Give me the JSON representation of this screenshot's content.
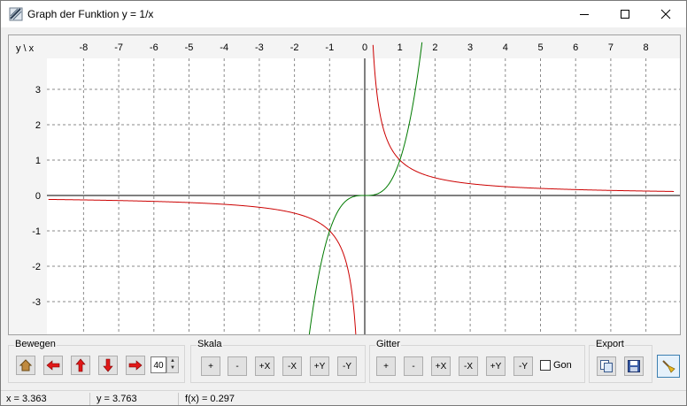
{
  "window": {
    "title": "Graph der Funktion y = 1/x"
  },
  "plot": {
    "corner_label": "y \\ x",
    "x_ticks": [
      "-8",
      "-7",
      "-6",
      "-5",
      "-4",
      "-3",
      "-2",
      "-1",
      "0",
      "1",
      "2",
      "3",
      "4",
      "5",
      "6",
      "7",
      "8"
    ],
    "y_ticks": [
      "3",
      "2",
      "1",
      "0",
      "-1",
      "-2",
      "-3"
    ],
    "xlim": [
      -9,
      8.8
    ],
    "ylim": [
      -3.9,
      3.9
    ],
    "grid": true,
    "curve_colors": {
      "function": "#cc0000",
      "second": "#007a00"
    }
  },
  "chart_data": {
    "type": "line",
    "series": [
      {
        "expression": "y = 1/x",
        "color": "#cc0000"
      },
      {
        "expression": "y = x^3",
        "color": "#007a00"
      }
    ],
    "xlim": [
      -9,
      8.8
    ],
    "ylim": [
      -3.9,
      3.9
    ],
    "grid": true
  },
  "toolbar": {
    "bewegen": {
      "title": "Bewegen",
      "step_value": "40"
    },
    "skala": {
      "title": "Skala",
      "buttons": [
        "+",
        "-",
        "+X",
        "-X",
        "+Y",
        "-Y"
      ]
    },
    "gitter": {
      "title": "Gitter",
      "buttons": [
        "+",
        "-",
        "+X",
        "-X",
        "+Y",
        "-Y"
      ],
      "gon_label": "Gon"
    },
    "export": {
      "title": "Export"
    }
  },
  "status": {
    "x": "x = 3.363",
    "y": "y = 3.763",
    "fx": "f(x) = 0.297"
  }
}
